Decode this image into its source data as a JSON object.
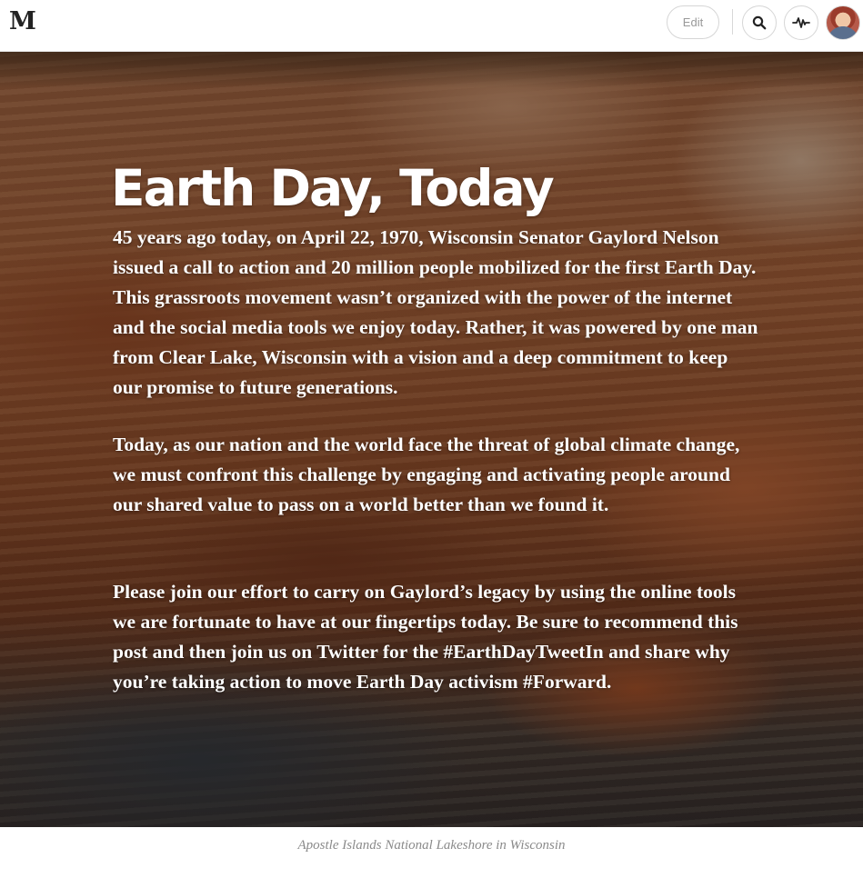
{
  "topbar": {
    "logo": "M",
    "edit_label": "Edit",
    "icons": {
      "search": "search-icon",
      "activity": "activity-icon",
      "avatar": "user-avatar"
    }
  },
  "article": {
    "title": "Earth Day, Today",
    "paragraphs": [
      "45 years ago today, on April 22, 1970, Wisconsin Senator Gaylord Nelson issued a call to action and 20 million people mobilized for the first Earth Day. This grassroots movement wasn’t organized with the power of the internet and the social media tools we enjoy today. Rather, it was powered by one man from Clear Lake, Wisconsin with a vision and a deep commitment to keep our promise to future generations.",
      "Today, as our nation and the world face the threat of global climate change, we must confront this challenge by engaging and activating people around our shared value to pass on a world better than we found it.",
      "Please join our effort to carry on Gaylord’s legacy by using the online tools we are fortunate to have at our fingertips today. Be sure to recommend this post and then join us on Twitter for the #EarthDayTweetIn and share why you’re taking action to move Earth Day activism #Forward."
    ],
    "caption": "Apostle Islands National Lakeshore in Wisconsin"
  },
  "colors": {
    "text_on_image": "#ffffff",
    "caption": "#8a8a8a",
    "border": "#d6d6d6"
  }
}
